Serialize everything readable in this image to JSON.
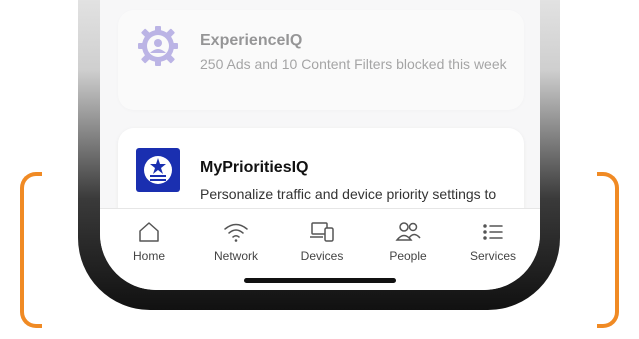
{
  "cards": [
    {
      "title": "ExperienceIQ",
      "description": "250 Ads and 10 Content Filters blocked this week",
      "icon": "gear-user-icon"
    },
    {
      "title": "MyPrioritiesIQ",
      "description": "Personalize traffic and device priority settings to enhance your network performance",
      "icon": "priority-badge-icon"
    }
  ],
  "tabs": [
    {
      "label": "Home",
      "icon": "home-icon"
    },
    {
      "label": "Network",
      "icon": "wifi-icon"
    },
    {
      "label": "Devices",
      "icon": "devices-icon"
    },
    {
      "label": "People",
      "icon": "people-icon"
    },
    {
      "label": "Services",
      "icon": "list-icon"
    }
  ],
  "colors": {
    "accent_bracket": "#f08a24",
    "experienceiq_icon": "#6a5acd",
    "priorities_icon": "#1a2fb0"
  }
}
